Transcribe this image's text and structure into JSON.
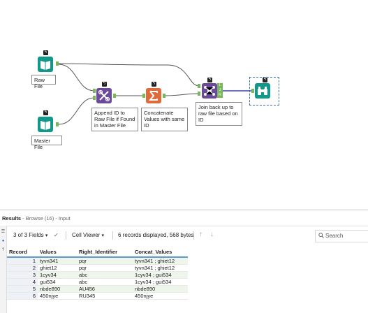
{
  "workflow": {
    "tools": [
      {
        "id": "raw_file",
        "label": "Raw File",
        "icon": "book-input-icon",
        "color": "#11988a"
      },
      {
        "id": "master_file",
        "label": "Master File",
        "icon": "book-input-icon",
        "color": "#11988a"
      },
      {
        "id": "append",
        "label": "Append ID to\nRaw File if Found\nin Master File",
        "icon": "append-fields-icon",
        "color": "#6b4a9b"
      },
      {
        "id": "concat",
        "label": "Concatenate\nValues with same\nID",
        "icon": "summarize-sigma-icon",
        "color": "#e06b3a"
      },
      {
        "id": "join",
        "label": "Join back up to\nraw file based on\nID",
        "icon": "join-icon",
        "color": "#6b4a9b"
      },
      {
        "id": "browse",
        "label": "",
        "icon": "binoculars-browse-icon",
        "color": "#11988a"
      }
    ],
    "join_ports": {
      "L": "L",
      "J": "J",
      "R": "R"
    }
  },
  "results": {
    "title": "Results",
    "subtitle": " - Browse (16) - Input",
    "fields": "3 of 3 Fields",
    "viewer": "Cell Viewer",
    "summary": "6 records displayed, 568 bytes",
    "search_placeholder": "Search",
    "columns": [
      "Record",
      "Values",
      "Right_Identifier",
      "Concat_Values"
    ],
    "rows": [
      [
        "1",
        "tyvn341",
        "pqr",
        "tyvn341 ; ghiet12"
      ],
      [
        "2",
        "ghiet12",
        "pqr",
        "tyvn341 ; ghiet12"
      ],
      [
        "3",
        "1cyv34",
        "abc",
        "1cyv34 ; gui534"
      ],
      [
        "4",
        "gui534",
        "abc",
        "1cyv34 ; gui534"
      ],
      [
        "5",
        "nbde890",
        "AU456",
        "nbde890"
      ],
      [
        "6",
        "450njye",
        "RU345",
        "450njye"
      ]
    ]
  }
}
